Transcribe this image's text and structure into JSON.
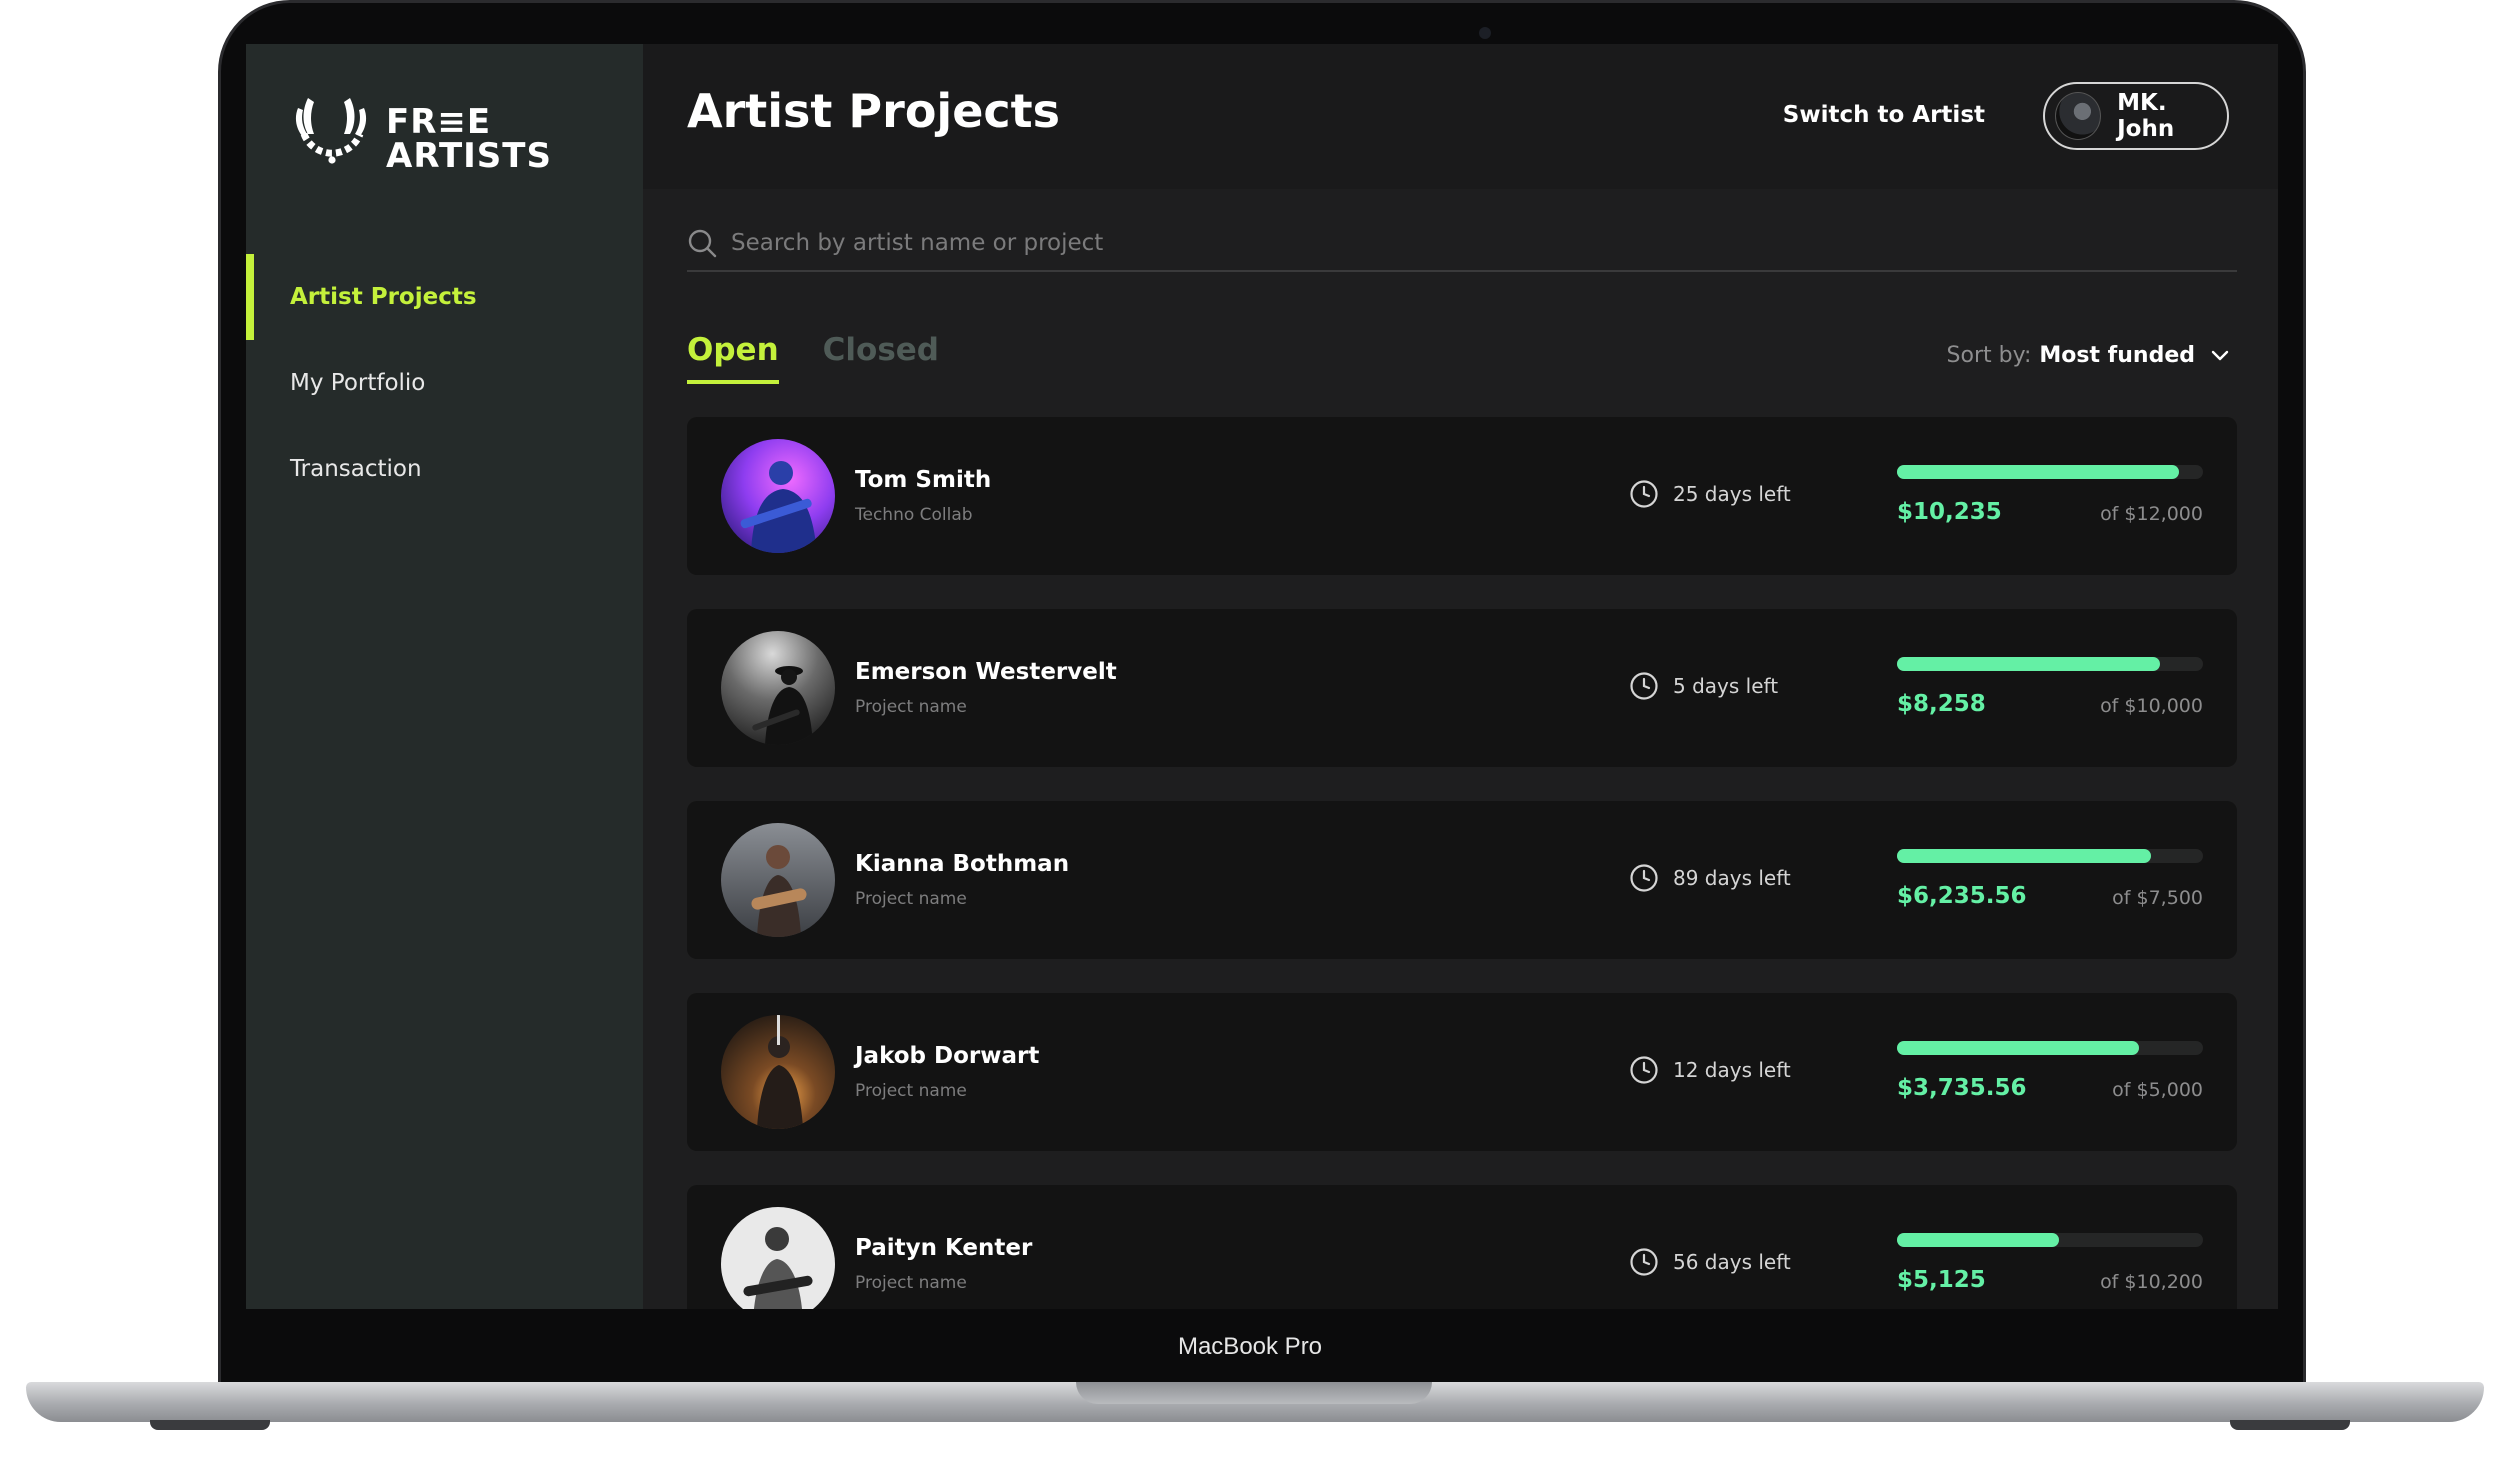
{
  "device": {
    "label": "MacBook Pro"
  },
  "brand": {
    "logo_line1": "FR≡E",
    "logo_line2": "ARTISTS",
    "accent": "#c4f13b",
    "success": "#64f0a5"
  },
  "sidebar": {
    "items": [
      {
        "label": "Artist Projects",
        "active": true
      },
      {
        "label": "My Portfolio",
        "active": false
      },
      {
        "label": "Transaction",
        "active": false
      }
    ]
  },
  "header": {
    "title": "Artist Projects",
    "switch_label": "Switch to Artist",
    "user_name": "MK. John"
  },
  "search": {
    "placeholder": "Search by artist name or project",
    "icon": "search-icon"
  },
  "tabs": [
    {
      "label": "Open",
      "active": true
    },
    {
      "label": "Closed",
      "active": false
    }
  ],
  "sort": {
    "label": "Sort by:",
    "value": "Most funded",
    "icon": "chevron-down-icon"
  },
  "projects": [
    {
      "artist": "Tom Smith",
      "project": "Techno Collab",
      "days_left": "25 days left",
      "raised": "$10,235",
      "goal": "of $12,000",
      "progress": 0.92
    },
    {
      "artist": "Emerson Westervelt",
      "project": "Project name",
      "days_left": "5 days left",
      "raised": "$8,258",
      "goal": "of $10,000",
      "progress": 0.86
    },
    {
      "artist": "Kianna Bothman",
      "project": "Project name",
      "days_left": "89 days left",
      "raised": "$6,235.56",
      "goal": "of $7,500",
      "progress": 0.83
    },
    {
      "artist": "Jakob Dorwart",
      "project": "Project name",
      "days_left": "12 days left",
      "raised": "$3,735.56",
      "goal": "of $5,000",
      "progress": 0.79
    },
    {
      "artist": "Paityn Kenter",
      "project": "Project name",
      "days_left": "56 days left",
      "raised": "$5,125",
      "goal": "of $10,200",
      "progress": 0.53
    }
  ]
}
